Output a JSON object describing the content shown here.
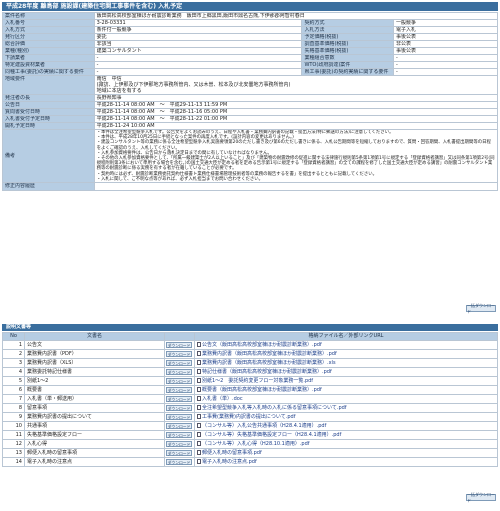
{
  "title": "平成28年度 離島部 施設課(建築住宅関工事事件を含む) 入札予定",
  "info_rows": [
    {
      "k": "案件名称",
      "v": "飯田高松高校部室棟ほか耐震診断業務　飯田市上郷黒田,飯田市鼎名古熊,下伊那郡阿智村春日"
    },
    {
      "k": "入札番号",
      "v": "3-28-03331",
      "k2": "契約方式",
      "v2": "一般競争"
    },
    {
      "k": "入札方式",
      "v": "条件付一般競争",
      "k2": "入札方法",
      "v2": "電子入札"
    },
    {
      "k": "発行区分",
      "v": "委託",
      "k2": "予定価格(税抜)",
      "v2": "事後公表"
    },
    {
      "k": "総合評価",
      "v": "非該当",
      "k2": "調査基準価格(税抜)",
      "v2": "非公表"
    },
    {
      "k": "業種(種別)",
      "v": "建築コンサルタント",
      "k2": "失格基準価格(税抜)",
      "v2": "事後公表"
    },
    {
      "k": "下請業者",
      "v": "-",
      "k2": "業種組合意数",
      "v2": "-"
    },
    {
      "k": "特定建設資材業者",
      "v": "-",
      "k2": "WTO(政府調達)案件",
      "v2": "-"
    },
    {
      "k": "同種工事(委託)の実績に関する要件",
      "v": "-",
      "k2": "県工事(委託)の契約実績に関する要件",
      "v2": "-"
    },
    {
      "k": "地域要件",
      "v": "南信　中信\n(諏訪、上伊那及び下伊那地方事務所管内、又は木曽、松本及び北安曇地方事務所管内)\n地域に本店を有する"
    },
    {
      "k": "発注者の長",
      "v": "長野県知事"
    },
    {
      "k": "公告日",
      "v": "平成28-11-14 08:00 AM　〜　平成29-11-13 11:59 PM"
    },
    {
      "k": "質問書受付日時",
      "v": "平成28-11-14 08:00 AM　〜　平成28-11-16 05:00 PM"
    },
    {
      "k": "入札書受付予定日時",
      "v": "平成28-11-14 08:00 AM　〜　平成28-11-22 01:00 PM"
    },
    {
      "k": "開札予定日時",
      "v": "平成28-11-24 10:00 AM"
    }
  ],
  "remarks_label": "備考",
  "remarks_text": "・本件は全注希望型競争入札です。公告文をよくお読みのうえ、日程や入札書・業務費内訳書の記載・提出方法(特に郵送の方法)に注意してください。\n・本件は、平成28年10月25日に手続となった案件の再度入札です。(設計内容の変更はありません。)\n・建設コンサルタント等の業務に係る全注希望型競争入札実施要領第20のただし書き及び第6のただし書きに係る、入札公告期間等を短縮しておりますので、質問・回答期間、入札書提出期間等の日程をよくご確認のうえ、入札してください。\n・入札参加資格要件は、公告日から落札決定日までの間に有していなければなりません。\n・その他の入札参加資格要件として、「所属一級建築士が2人以上いること」及び「建築物の耐震改修の促進に関する法律施行規則第5条第1項第1号に規定する「登録資格者講習」又は同条第1項第2号(同規程附則第3条において準用する場合を含む。)の国土交通大臣が定める者を定める告示第1号に規定する「登録資格者講習」の全ての課程を修了した国土交通大臣が定める講習」の耐震コンサルタント業務等の耐震診断に係る実務を有する者が在籍していることが必要です。\n・契約時には必ず、耐震診断業務委託契約仕様書ト業務仕様書場管理技術者等の業務の報告するを書」を提出するとともに記載してください。\n・入札に関して、ご不明な点等があれば、必ず入札担当までお問い合わせください。",
  "history_label": "修正内容履歴",
  "download_all_label": "一括ダウンロード",
  "section_title": "説明文書等",
  "files_header": {
    "no": "No",
    "name": "文書名",
    "file": "格納ファイル名／外部リンクURL"
  },
  "download_btn_label": "ダウンロード",
  "files": [
    {
      "no": "1",
      "name": "公告文",
      "file": "公告文（飯田高松高校部室棟ほか耐震診断業務）.pdf"
    },
    {
      "no": "2",
      "name": "業務費内訳書（PDF）",
      "file": "業務費内訳書（飯田高松高校部室棟ほか耐震診断業務）.pdf"
    },
    {
      "no": "3",
      "name": "業務費内訳書（XLS）",
      "file": "業務費内訳書（飯田高松高校部室棟ほか耐震診断業務）.xls"
    },
    {
      "no": "4",
      "name": "業務委託特記仕様書",
      "file": "特記仕様書（飯田高松高校部室棟ほか耐震診断業務）.pdf"
    },
    {
      "no": "5",
      "name": "別紙1〜2",
      "file": "別紙1〜2　委託契約変更フロー対象業務一覧.pdf"
    },
    {
      "no": "6",
      "name": "概要書",
      "file": "概要書（飯田高松高校部室棟ほか耐震診断業務）.pdf"
    },
    {
      "no": "7",
      "name": "入札書（単・郵送用）",
      "file": "入札書（単）.doc"
    },
    {
      "no": "8",
      "name": "留意事項",
      "file": "全注希望型競争入札等入札時の入札に係る留意事項について.pdf"
    },
    {
      "no": "9",
      "name": "業務費内訳書の提出について",
      "file": "工事費(業務費)内訳書の提出について.pdf"
    },
    {
      "no": "10",
      "name": "共通事項",
      "file": "（コンサル等）入札公告共通事項（H28.4.1適用）.pdf"
    },
    {
      "no": "11",
      "name": "失格基準価格設定フロー",
      "file": "（コンサル等）失格基準価格設定フロー（H28.4.1適用）.pdf"
    },
    {
      "no": "12",
      "name": "入札心得",
      "file": "（コンサル等）入札心得（H28.10.1適用）.pdf"
    },
    {
      "no": "13",
      "name": "郵便入札時の留意事項",
      "file": "郵便入札時の留意事項.pdf"
    },
    {
      "no": "14",
      "name": "電子入札時の注意点",
      "file": "電子入札時の注意点.pdf"
    }
  ]
}
